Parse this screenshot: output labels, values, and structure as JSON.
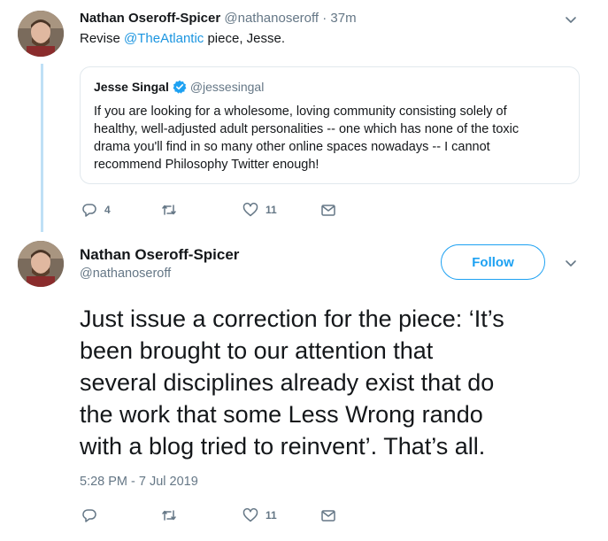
{
  "tweet1": {
    "name": "Nathan Oseroff-Spicer",
    "handle": "@nathanoseroff",
    "separator": "·",
    "time": "37m",
    "text_before": "Revise ",
    "mention": "@TheAtlantic",
    "text_after": " piece, Jesse.",
    "quote": {
      "name": "Jesse Singal",
      "handle": "@jessesingal",
      "verified": true,
      "lines": [
        "If you are looking for a wholesome, loving community consisting solely of",
        "healthy, well-adjusted adult personalities -- one which has none of the toxic",
        "drama you'll find in so many other online spaces nowadays -- I cannot",
        "recommend Philosophy Twitter enough!"
      ]
    },
    "actions": {
      "replies": "4",
      "retweets": "",
      "likes": "11"
    }
  },
  "tweet2": {
    "name": "Nathan Oseroff-Spicer",
    "handle": "@nathanoseroff",
    "follow_label": "Follow",
    "lines": [
      "Just issue a correction for the piece: ‘It’s",
      "been brought to our attention that",
      "several disciplines already exist that do",
      "the work that some Less Wrong rando",
      "with a blog tried to reinvent’. That’s all."
    ],
    "timestamp": "5:28 PM - 7 Jul 2019",
    "actions": {
      "replies": "",
      "retweets": "",
      "likes": "11"
    }
  },
  "colors": {
    "accent": "#1da1f2",
    "link": "#1b95e0",
    "muted": "#657786",
    "thread_line": "#bfe0f6"
  },
  "icons": [
    "chevron-down-icon",
    "verified-badge-icon",
    "reply-icon",
    "retweet-icon",
    "like-icon",
    "message-icon"
  ]
}
